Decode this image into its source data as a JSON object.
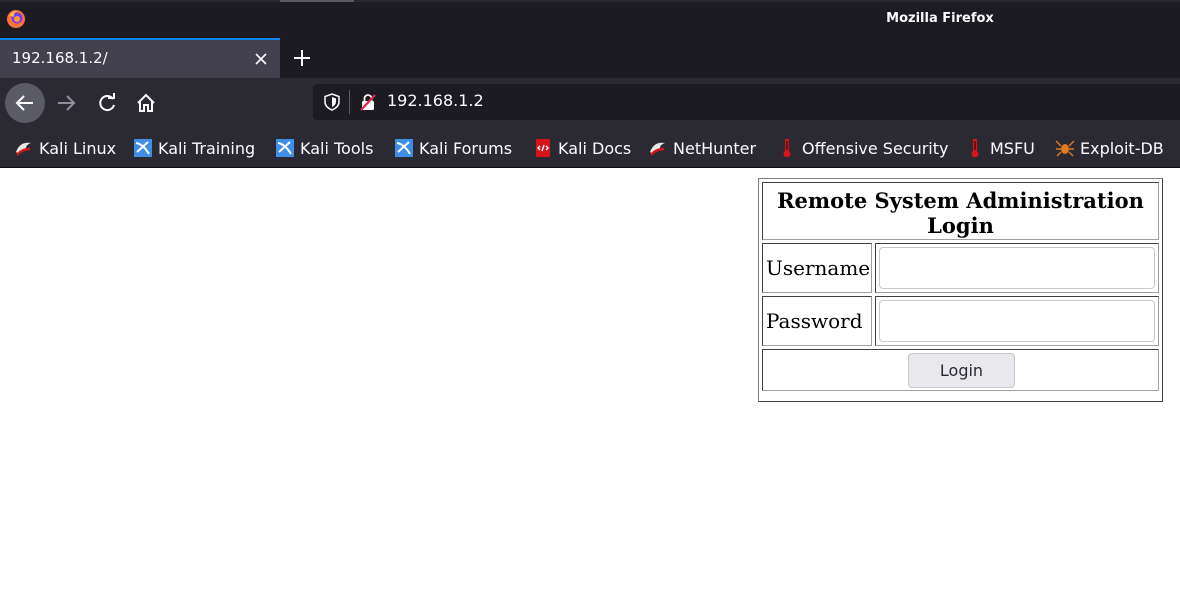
{
  "window": {
    "title": "Mozilla Firefox"
  },
  "tabs": [
    {
      "label": "192.168.1.2/",
      "active": true
    }
  ],
  "navbar": {
    "url": "192.168.1.2",
    "icons": [
      "back-arrow-icon",
      "forward-arrow-icon",
      "reload-icon",
      "home-icon",
      "tracking-shield-icon",
      "insecure-lock-icon"
    ]
  },
  "bookmarks": [
    {
      "label": "Kali Linux",
      "icon": "kali-dragon-icon"
    },
    {
      "label": "Kali Training",
      "icon": "kali-training-icon"
    },
    {
      "label": "Kali Tools",
      "icon": "kali-tools-icon"
    },
    {
      "label": "Kali Forums",
      "icon": "kali-forums-icon"
    },
    {
      "label": "Kali Docs",
      "icon": "kali-docs-icon"
    },
    {
      "label": "NetHunter",
      "icon": "nethunter-icon"
    },
    {
      "label": "Offensive Security",
      "icon": "offsec-icon"
    },
    {
      "label": "MSFU",
      "icon": "msfu-icon"
    },
    {
      "label": "Exploit-DB",
      "icon": "exploit-db-icon"
    }
  ],
  "login": {
    "title": "Remote System Administration Login",
    "username_label": "Username",
    "username_value": "",
    "password_label": "Password",
    "password_value": "",
    "submit_label": "Login"
  },
  "colors": {
    "chrome_dark": "#1c1b22",
    "toolbar": "#2b2a33",
    "active_tab": "#42414d",
    "accent": "#0a84ff"
  }
}
